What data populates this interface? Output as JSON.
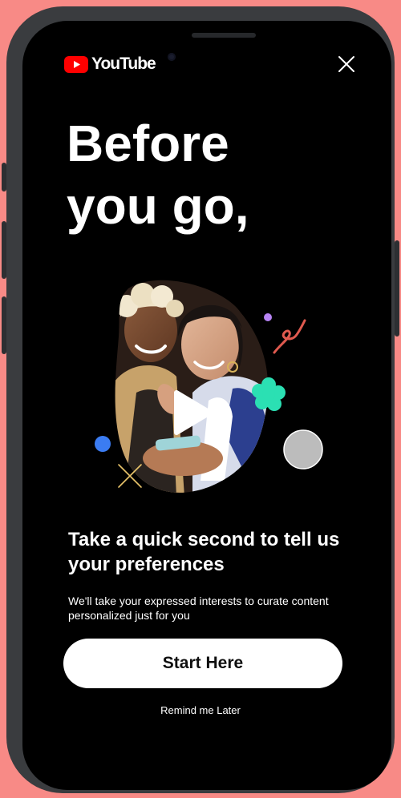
{
  "app": {
    "logo_text": "YouTube",
    "brand_color": "#ff0000"
  },
  "icons": {
    "logo": "youtube-play-logo-icon",
    "close": "close-icon",
    "play": "play-icon"
  },
  "modal": {
    "headline_line1": "Before",
    "headline_line2": "you go,",
    "subheadline": "Take a quick second to tell us your preferences",
    "description": "We'll take your expressed interests to curate content personalized just for you",
    "primary_button_label": "Start Here",
    "secondary_link_label": "Remind me Later"
  },
  "colors": {
    "background": "#000000",
    "page_background": "#f88a86",
    "button_background": "#ffffff",
    "accent_purple": "#b784f5",
    "accent_red": "#e05a4f",
    "accent_teal": "#2be0b3",
    "accent_blue": "#3b7cf2",
    "accent_yellow": "#e8c46a",
    "accent_gray": "#bcbcbc"
  }
}
